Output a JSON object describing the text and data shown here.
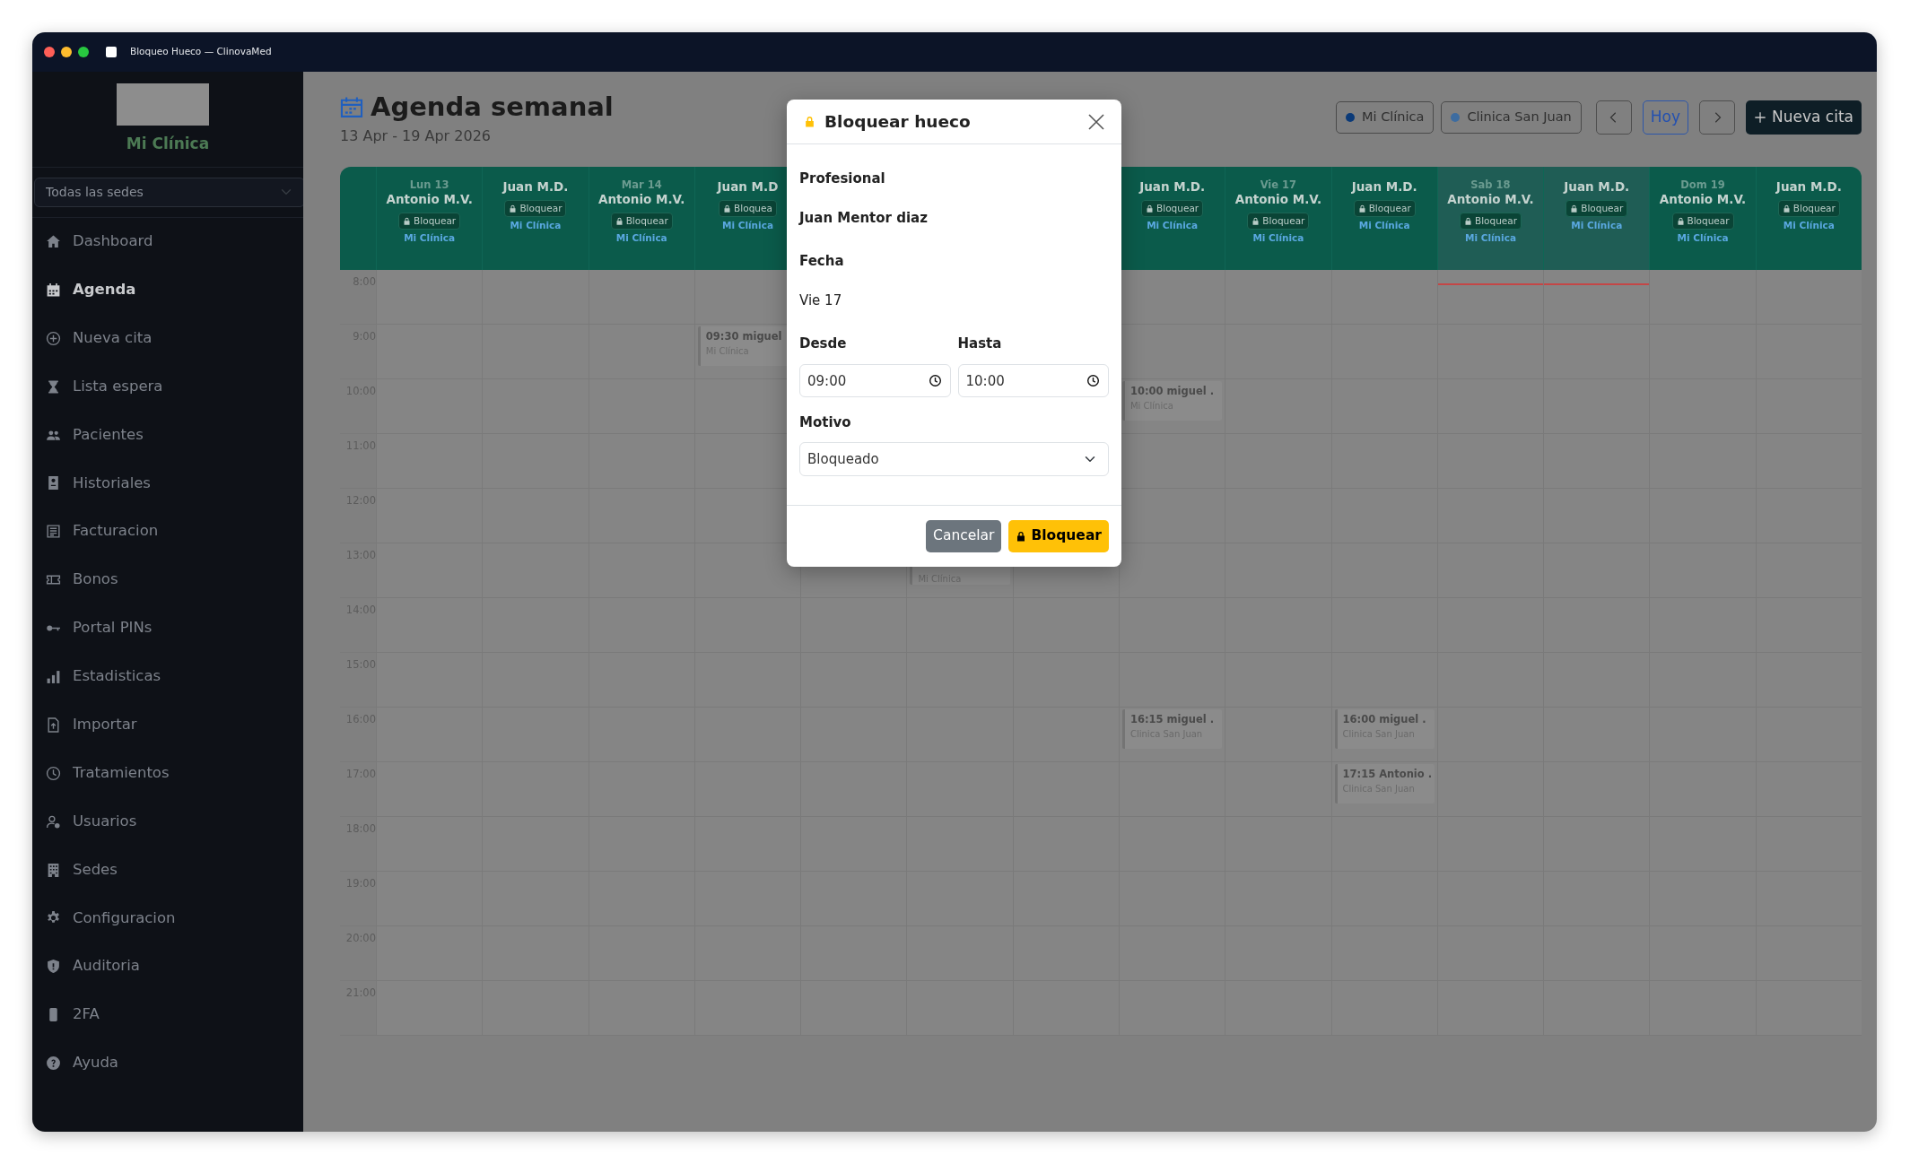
{
  "window": {
    "title": "Bloqueo Hueco — ClinovaMed"
  },
  "sidebar": {
    "clinic_name": "Mi Clínica",
    "site_select": "Todas las sedes",
    "items": [
      {
        "label": "Dashboard",
        "kind": "house",
        "selected": false
      },
      {
        "label": "Agenda",
        "kind": "calendar",
        "selected": true
      },
      {
        "label": "Nueva cita",
        "kind": "plus",
        "selected": false
      },
      {
        "label": "Lista espera",
        "kind": "hourglass",
        "selected": false
      },
      {
        "label": "Pacientes",
        "kind": "people",
        "selected": false
      },
      {
        "label": "Historiales",
        "kind": "file",
        "selected": false
      },
      {
        "label": "Facturacion",
        "kind": "receipt",
        "selected": false
      },
      {
        "label": "Bonos",
        "kind": "ticket",
        "selected": false
      },
      {
        "label": "Portal PINs",
        "kind": "key",
        "selected": false
      },
      {
        "label": "Estadisticas",
        "kind": "bars",
        "selected": false
      },
      {
        "label": "Importar",
        "kind": "upload",
        "selected": false
      },
      {
        "label": "Tratamientos",
        "kind": "clock",
        "selected": false
      },
      {
        "label": "Usuarios",
        "kind": "usergear",
        "selected": false
      },
      {
        "label": "Sedes",
        "kind": "building",
        "selected": false
      },
      {
        "label": "Configuracion",
        "kind": "gear",
        "selected": false
      },
      {
        "label": "Auditoria",
        "kind": "shield",
        "selected": false
      },
      {
        "label": "2FA",
        "kind": "phone",
        "selected": false
      },
      {
        "label": "Ayuda",
        "kind": "help",
        "selected": false
      }
    ]
  },
  "header": {
    "title": "Agenda semanal",
    "subtitle": "13 Apr - 19 Apr 2026",
    "legend": [
      {
        "label": "Mi Clínica",
        "color": "#0b3a78"
      },
      {
        "label": "Clinica San Juan",
        "color": "#3d6ca0"
      }
    ],
    "today_button": "Hoy",
    "new_button": "Nueva cita"
  },
  "calendar": {
    "hours": [
      "8:00",
      "9:00",
      "10:00",
      "11:00",
      "12:00",
      "13:00",
      "14:00",
      "15:00",
      "16:00",
      "17:00",
      "18:00",
      "19:00",
      "20:00",
      "21:00"
    ],
    "columns": [
      {
        "day": "Lun 13",
        "professional": "Antonio M.V.",
        "action": "Bloquear",
        "clinic": "Mi Clínica",
        "today": false
      },
      {
        "professional": "Juan M.D.",
        "action": "Bloquear",
        "clinic": "Mi Clínica",
        "today": false
      },
      {
        "day": "Mar 14",
        "professional": "Antonio M.V.",
        "action": "Bloquear",
        "clinic": "Mi Clínica",
        "today": false
      },
      {
        "professional": "Juan M.D",
        "action": "Bloquea",
        "clinic": "Mi Clínica",
        "today": false,
        "slots": [
          {
            "busy": false
          },
          {
            "busy": true,
            "title": "09:30 miguel",
            "clinic": "Mi Clínica"
          }
        ]
      },
      {},
      {
        "slots_from_end": [
          {
            "busy": false
          },
          {
            "busy": false
          },
          {
            "busy": false
          },
          {
            "busy": false
          },
          {
            "busy": false
          },
          {
            "busy": false
          },
          {
            "busy": false
          },
          {
            "busy": false
          },
          {
            "busy": true,
            "clinic": "Mi Clínica"
          }
        ]
      },
      {},
      {
        "professional": "Juan M.D.",
        "action": "Bloquear",
        "clinic": "Mi Clínica",
        "today": false,
        "slots": [
          {
            "busy": false
          },
          {
            "busy": false
          },
          {
            "busy": true,
            "title": "10:00 miguel .",
            "clinic": "Mi Clínica"
          },
          {
            "busy": false
          },
          {
            "busy": false
          },
          {
            "busy": false
          },
          {
            "busy": false
          },
          {
            "busy": false
          },
          {
            "busy": true,
            "title": "16:15 miguel .",
            "clinic": "Clinica San Juan"
          }
        ]
      },
      {
        "day": "Vie 17",
        "professional": "Antonio M.V.",
        "action": "Bloquear",
        "clinic": "Mi Clínica",
        "today": false
      },
      {
        "professional": "Juan M.D.",
        "action": "Bloquear",
        "clinic": "Mi Clínica",
        "today": false,
        "slots": [
          {
            "busy": false
          },
          {
            "busy": false
          },
          {
            "busy": false
          },
          {
            "busy": false
          },
          {
            "busy": false
          },
          {
            "busy": false
          },
          {
            "busy": false
          },
          {
            "busy": false
          },
          {
            "busy": true,
            "title": "16:00 miguel .",
            "clinic": "Clinica San Juan"
          },
          {
            "busy": true,
            "title": "17:15 Antonio .",
            "clinic": "Clinica San Juan"
          }
        ]
      },
      {
        "day": "Sab 18",
        "professional": "Antonio M.V.",
        "action": "Bloquear",
        "clinic": "Mi Clínica",
        "today": true
      },
      {
        "professional": "Juan M.D.",
        "action": "Bloquear",
        "clinic": "Mi Clínica",
        "today": true
      },
      {
        "day": "Dom 19",
        "professional": "Antonio M.V.",
        "action": "Bloquear",
        "clinic": "Mi Clínica",
        "today": false
      },
      {
        "professional": "Juan M.D.",
        "action": "Bloquear",
        "clinic": "Mi Clínica",
        "today": false
      }
    ]
  },
  "modal": {
    "title": "Bloquear hueco",
    "fields": [
      {
        "label": "Profesional",
        "value": "Juan Mentor diaz",
        "kind": "strong"
      },
      {
        "label": "Fecha",
        "value": "Vie 17",
        "kind": "plain"
      }
    ],
    "from": {
      "label": "Desde",
      "value": "09:00"
    },
    "to": {
      "label": "Hasta",
      "value": "10:00"
    },
    "reason": {
      "label": "Motivo",
      "value": "Bloqueado"
    },
    "buttons": [
      {
        "label": "Cancelar",
        "kind": "cancel"
      },
      {
        "label": "Bloquear",
        "kind": "confirm"
      }
    ]
  }
}
